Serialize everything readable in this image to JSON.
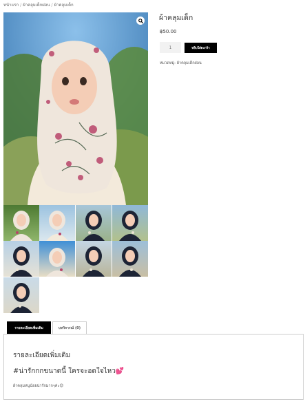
{
  "breadcrumb": {
    "home": "หน้าแรก",
    "category": "ผ้าคลุมเด็กผ่อน",
    "current": "ผ้าคลุมเด็ก",
    "separator": "/"
  },
  "gallery": {
    "main_alt": "child wearing floral hijab",
    "zoom_icon": "search-icon",
    "thumbnail_count": 9
  },
  "product": {
    "title": "ผ้าคลุมเด็ก",
    "price": "฿50.00",
    "quantity": "1",
    "add_to_cart": "หยิบใส่ตะกร้า",
    "category_label": "หมวดหมู่:",
    "category_value": "ผ้าคลุมเด็กผ่อน"
  },
  "tabs": [
    {
      "label": "รายละเอียดเพิ่มเติม",
      "active": true
    },
    {
      "label": "บทวิจารณ์ (0)",
      "active": false
    }
  ],
  "description": {
    "heading": "รายละเอียดเพิ่มเติม",
    "hashtag": "#น่ารักกกขนาดนี้ ใครจะอดใจไหว💕",
    "note": "ผ้าคลุมหนูน้อยน่ารักมากๆค่ะ😍"
  },
  "colors": {
    "button": "#000000",
    "accent_text": "#ffffff"
  }
}
